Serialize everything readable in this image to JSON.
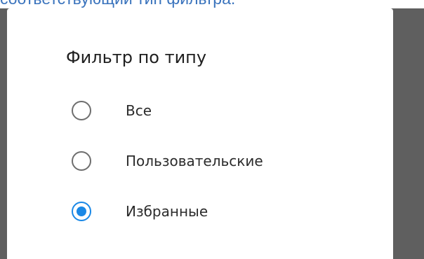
{
  "background_caption": {
    "text": "соответствующий тип фильтра."
  },
  "dialog": {
    "title": "Фильтр по типу",
    "options": [
      {
        "label": "Все",
        "selected": false
      },
      {
        "label": "Пользовательские",
        "selected": false
      },
      {
        "label": "Избранные",
        "selected": true
      }
    ]
  },
  "colors": {
    "accent": "#1a88e6",
    "scrim": "#5f5f5f",
    "radio_unchecked": "#6e6e6e",
    "caption_link": "#3b74bd"
  }
}
